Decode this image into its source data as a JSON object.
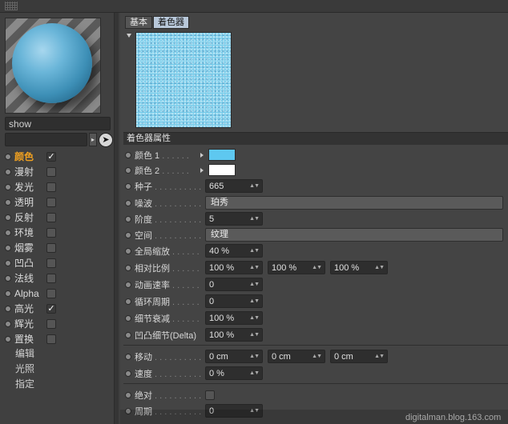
{
  "left_panel": {
    "material_name": "show",
    "channels": [
      {
        "label": "颜色",
        "checked": true,
        "active": true
      },
      {
        "label": "漫射",
        "checked": false
      },
      {
        "label": "发光",
        "checked": false
      },
      {
        "label": "透明",
        "checked": false
      },
      {
        "label": "反射",
        "checked": false
      },
      {
        "label": "环境",
        "checked": false
      },
      {
        "label": "烟雾",
        "checked": false
      },
      {
        "label": "凹凸",
        "checked": false
      },
      {
        "label": "法线",
        "checked": false
      },
      {
        "label": "Alpha",
        "checked": false
      },
      {
        "label": "高光",
        "checked": true
      },
      {
        "label": "辉光",
        "checked": false
      },
      {
        "label": "置换",
        "checked": false
      }
    ],
    "extras": [
      "编辑",
      "光照",
      "指定"
    ],
    "check_mark": "✓"
  },
  "tabs": [
    {
      "label": "基本",
      "active": false
    },
    {
      "label": "着色器",
      "active": true
    }
  ],
  "section_title": "着色器属性",
  "params": {
    "color1": {
      "label": "颜色 1",
      "color": "#5ec8f0"
    },
    "color2": {
      "label": "颜色 2",
      "color": "#ffffff"
    },
    "seed": {
      "label": "种子",
      "value": "665"
    },
    "noise": {
      "label": "噪波",
      "value": "珀秀"
    },
    "octaves": {
      "label": "阶度",
      "value": "5"
    },
    "space": {
      "label": "空间",
      "value": "纹理"
    },
    "global_scale": {
      "label": "全局缩放",
      "value": "40 %"
    },
    "relative_scale": {
      "label": "相对比例",
      "values": [
        "100 %",
        "100 %",
        "100 %"
      ]
    },
    "anim_speed": {
      "label": "动画速率",
      "value": "0"
    },
    "loop_period": {
      "label": "循环周期",
      "value": "0"
    },
    "detail_atten": {
      "label": "细节衰减",
      "value": "100 %"
    },
    "bump_detail": {
      "label": "凹凸细节(Delta)",
      "value": "100 %"
    },
    "move": {
      "label": "移动",
      "values": [
        "0 cm",
        "0 cm",
        "0 cm"
      ]
    },
    "speed": {
      "label": "速度",
      "value": "0 %"
    },
    "absolute": {
      "label": "绝对"
    },
    "period": {
      "label": "周期",
      "value": "0"
    }
  },
  "watermark": "digitalman.blog.163.com"
}
